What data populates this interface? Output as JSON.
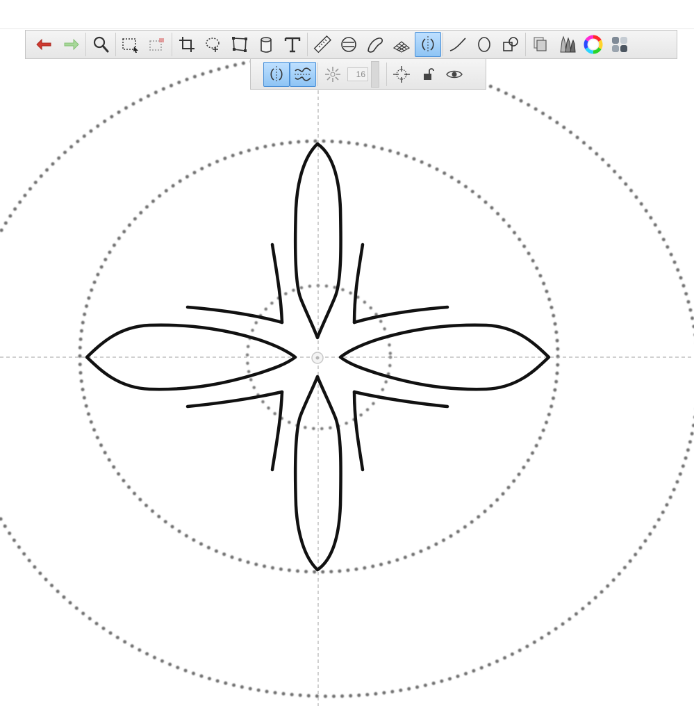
{
  "app": {
    "toolbar": {
      "tools": [
        {
          "name": "undo-icon",
          "color": "#d03a30"
        },
        {
          "name": "redo-icon",
          "color": "#9ad08a"
        },
        {
          "name": "zoom-icon"
        },
        {
          "name": "selection-icon"
        },
        {
          "name": "transform-selection-icon"
        },
        {
          "name": "crop-icon"
        },
        {
          "name": "lasso-icon"
        },
        {
          "name": "distort-icon"
        },
        {
          "name": "fill-bucket-icon"
        },
        {
          "name": "text-icon",
          "glyph": "T"
        },
        {
          "name": "ruler-icon"
        },
        {
          "name": "ellipse-guide-icon"
        },
        {
          "name": "french-curve-icon"
        },
        {
          "name": "perspective-grid-icon"
        },
        {
          "name": "symmetry-icon",
          "active": true
        },
        {
          "name": "stroke-line-icon"
        },
        {
          "name": "ellipse-icon"
        },
        {
          "name": "shapes-icon"
        },
        {
          "name": "layers-icon"
        },
        {
          "name": "brush-library-icon"
        },
        {
          "name": "color-wheel-icon"
        },
        {
          "name": "palettes-icon"
        }
      ]
    },
    "symmetry_toolbar": {
      "mirror_active": true,
      "wave_active": true,
      "sectors_value": "16"
    }
  },
  "colors": {
    "accent": "#4a8fd6",
    "stroke": "#111111",
    "guide": "#6e6e6e"
  }
}
